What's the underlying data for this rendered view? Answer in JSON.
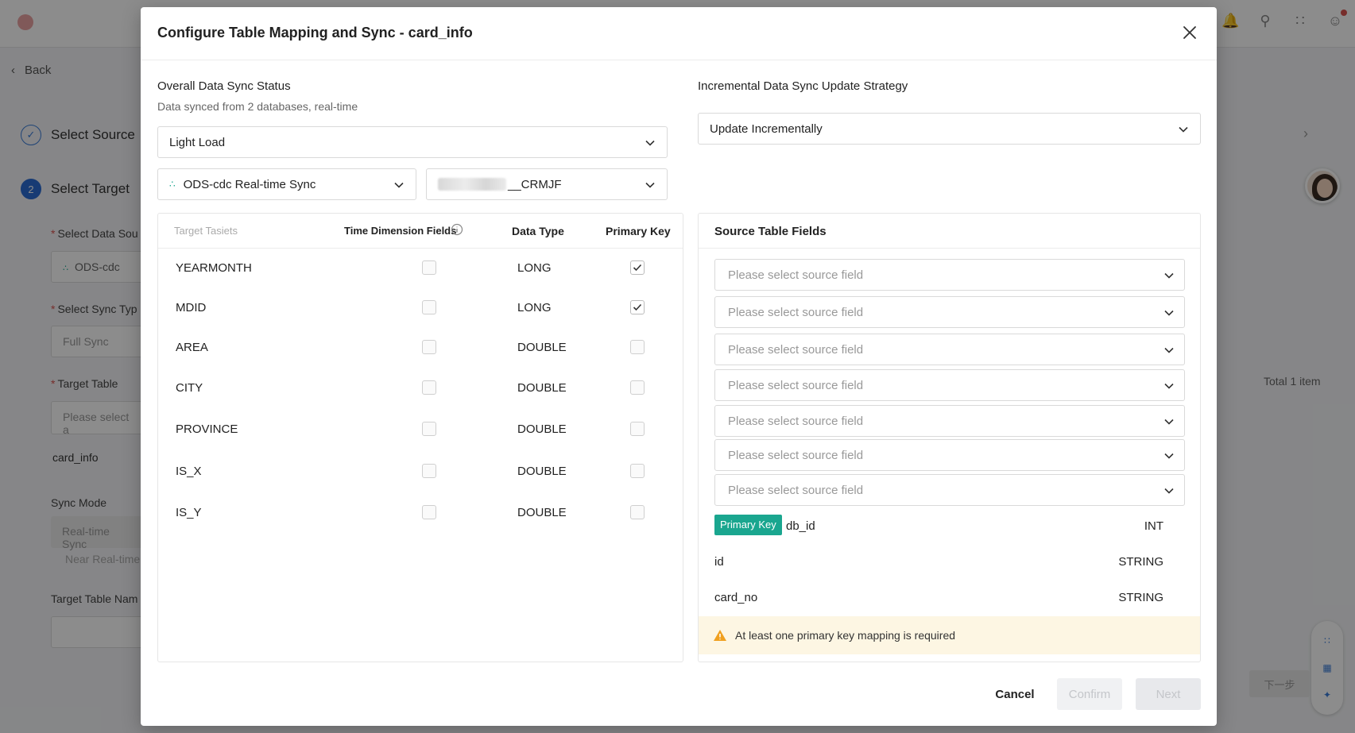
{
  "background": {
    "back_label": "Back",
    "steps": [
      {
        "num": "",
        "label": "Select Source"
      },
      {
        "num": "2",
        "label": "Select Target"
      }
    ],
    "fields": {
      "data_source_label": "Select Data Sou",
      "data_source_value": "ODS-cdc",
      "sync_type_label": "Select Sync Typ",
      "sync_type_value": "Full Sync",
      "target_table_label": "Target Table",
      "target_table_placeholder": "Please select a",
      "table_name": "card_info",
      "sync_mode_label": "Sync Mode",
      "sync_mode_opt1": "Real-time Sync",
      "sync_mode_opt2": "Near Real-time",
      "target_table_name_label": "Target Table Nam"
    },
    "total_label": "Total 1 item",
    "pager_label": "下一步"
  },
  "modal": {
    "title": "Configure Table Mapping and Sync - card_info",
    "left": {
      "status_title": "Overall Data Sync Status",
      "status_sub": "Data synced from 2 databases, real-time",
      "load_select": "Light Load",
      "source_select": "ODS-cdc Real-time Sync",
      "db_select_suffix": "__CRMJF"
    },
    "right": {
      "strategy_title": "Incremental Data Sync Update Strategy",
      "strategy_select": "Update Incrementally"
    },
    "table": {
      "headers": {
        "target": "Target Tasiets",
        "time_dim": "Time Dimension Fields",
        "data_type": "Data Type",
        "primary_key": "Primary Key"
      },
      "rows": [
        {
          "name": "YEARMONTH",
          "type": "LONG",
          "time_dim": false,
          "pk": true
        },
        {
          "name": "MDID",
          "type": "LONG",
          "time_dim": false,
          "pk": true
        },
        {
          "name": "AREA",
          "type": "DOUBLE",
          "time_dim": false,
          "pk": false
        },
        {
          "name": "CITY",
          "type": "DOUBLE",
          "time_dim": false,
          "pk": false
        },
        {
          "name": "PROVINCE",
          "type": "DOUBLE",
          "time_dim": false,
          "pk": false
        },
        {
          "name": "IS_X",
          "type": "DOUBLE",
          "time_dim": false,
          "pk": false
        },
        {
          "name": "IS_Y",
          "type": "DOUBLE",
          "time_dim": false,
          "pk": false
        }
      ]
    },
    "source": {
      "title": "Source Table Fields",
      "placeholder": "Please select source field",
      "fields": [
        {
          "badge": "Primary Key",
          "name": "db_id",
          "type": "INT"
        },
        {
          "badge": "",
          "name": "id",
          "type": "STRING"
        },
        {
          "badge": "",
          "name": "card_no",
          "type": "STRING"
        }
      ],
      "warning": "At least one primary key mapping is required"
    },
    "footer": {
      "cancel": "Cancel",
      "confirm": "Confirm",
      "next": "Next"
    }
  },
  "colors": {
    "accent_teal": "#1aa68f",
    "step_blue": "#2b6cd4",
    "warning_bg": "#fdf6e3",
    "warning_icon": "#f0a020"
  }
}
